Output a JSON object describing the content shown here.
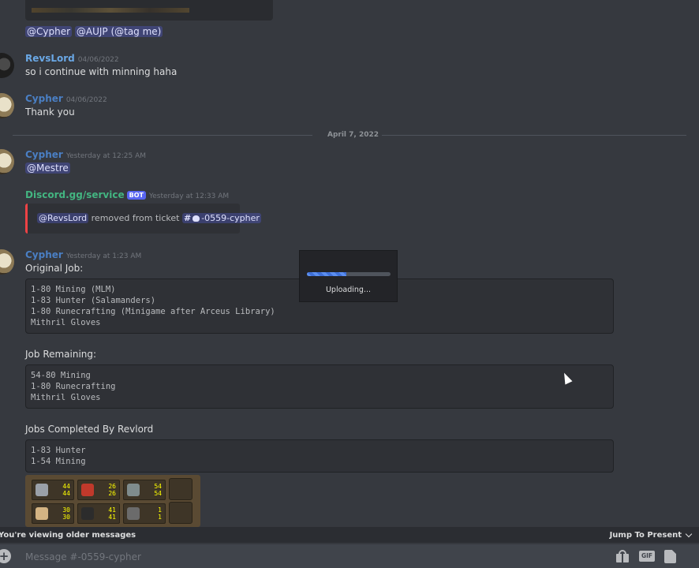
{
  "prev_message": {
    "mentions": [
      "@Cypher",
      "@AUJP (@tag me)"
    ]
  },
  "messages": [
    {
      "author": "RevsLord",
      "timestamp": "04/06/2022",
      "text": "so i continue with minning haha"
    },
    {
      "author": "Cypher",
      "timestamp": "04/06/2022",
      "text": "Thank you"
    }
  ],
  "date_divider": "April 7, 2022",
  "msg_mestre": {
    "author": "Cypher",
    "timestamp": "Yesterday at 12:25 AM",
    "mention": "@Mestre"
  },
  "bot_msg": {
    "author": "Discord.gg/service",
    "tag": "BOT",
    "timestamp": "Yesterday at 12:33 AM",
    "user_mention": "@RevsLord",
    "action": "removed from ticket",
    "channel": "-0559-cypher"
  },
  "job_msg": {
    "author": "Cypher",
    "timestamp": "Yesterday at 1:23 AM",
    "original_label": "Original Job:",
    "original_lines": [
      "1-80 Mining (MLM)",
      "1-83 Hunter (Salamanders)",
      "1-80 Runecrafting (Minigame after Arceus Library)",
      "Mithril Gloves"
    ],
    "remaining_label": "Job Remaining:",
    "remaining_lines": [
      "54-80 Mining",
      "1-80 Runecrafting",
      "Mithril Gloves"
    ],
    "completed_label": "Jobs Completed By Revlord",
    "completed_lines": [
      "1-83 Hunter",
      "1-54 Mining"
    ]
  },
  "skills": [
    {
      "icon": "attack-icon",
      "color": "#9aa0a8",
      "level_a": "44",
      "level_b": "44"
    },
    {
      "icon": "hitpoints-icon",
      "color": "#c0392b",
      "level_a": "26",
      "level_b": "26"
    },
    {
      "icon": "mining-icon",
      "color": "#7f8c8d",
      "level_a": "54",
      "level_b": "54"
    },
    {
      "icon": "strength-icon",
      "color": "#d4b483",
      "level_a": "30",
      "level_b": "30"
    },
    {
      "icon": "agility-icon",
      "color": "#2c2c2c",
      "level_a": "41",
      "level_b": "41"
    },
    {
      "icon": "smithing-icon",
      "color": "#6b6b6b",
      "level_a": "1",
      "level_b": "1"
    }
  ],
  "upload": {
    "text": "Uploading...",
    "progress": 0.47
  },
  "older_bar": {
    "text": "You're viewing older messages",
    "jump_label": "Jump To Present"
  },
  "input": {
    "placeholder": "Message #-0559-cypher"
  },
  "colors": {
    "background": "#36393f",
    "mention_bg": "#5865f2",
    "bot_author": "#43b581",
    "embed_border": "#ed4245"
  }
}
